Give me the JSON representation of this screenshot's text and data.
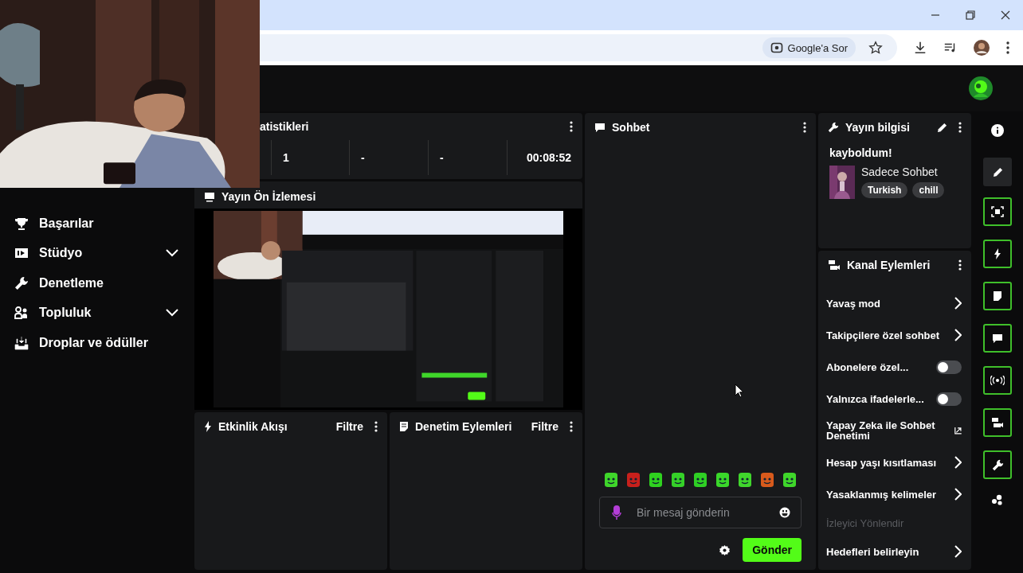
{
  "browser": {
    "ask_chip": "Google'a Sor"
  },
  "sidebar": {
    "items": [
      {
        "label": "Başarılar",
        "kind": "link"
      },
      {
        "label": "Stüdyo",
        "kind": "group"
      },
      {
        "label": "Denetleme",
        "kind": "link"
      },
      {
        "label": "Topluluk",
        "kind": "group"
      },
      {
        "label": "Droplar ve ödüller",
        "kind": "link"
      }
    ]
  },
  "stats": {
    "title": "atistikleri",
    "values": [
      "1",
      "-",
      "-",
      "00:08:52"
    ]
  },
  "preview": {
    "title": "Yayın Ön İzlemesi"
  },
  "panels": [
    {
      "title": "Etkinlik Akışı",
      "filter": "Filtre"
    },
    {
      "title": "Denetim Eylemleri",
      "filter": "Filtre"
    }
  ],
  "chat": {
    "title": "Sohbet",
    "placeholder": "Bir mesaj gönderin",
    "send": "Gönder"
  },
  "stream_info": {
    "heading": "Yayın bilgisi",
    "title": "kayboldum!",
    "category": "Sadece Sohbet",
    "tags": [
      "Turkish",
      "chill"
    ]
  },
  "channel_actions": {
    "heading": "Kanal Eylemleri",
    "items": [
      {
        "label": "Yavaş mod",
        "kind": "link",
        "disabled": false
      },
      {
        "label": "Takipçilere özel sohbet",
        "kind": "link",
        "disabled": false
      },
      {
        "label": "Abonelere özel...",
        "kind": "toggle",
        "on": false,
        "disabled": false
      },
      {
        "label": "Yalnızca ifadelerle...",
        "kind": "toggle",
        "on": false,
        "disabled": false
      },
      {
        "label": "Yapay Zeka ile Sohbet Denetimi",
        "kind": "external",
        "disabled": false
      },
      {
        "label": "Hesap yaşı kısıtlaması",
        "kind": "link",
        "disabled": false
      },
      {
        "label": "Yasaklanmış kelimeler",
        "kind": "link",
        "disabled": false
      },
      {
        "label": "İzleyici Yönlendir",
        "kind": "label",
        "disabled": true
      },
      {
        "label": "Hedefleri belirleyin",
        "kind": "link",
        "disabled": false
      }
    ]
  }
}
